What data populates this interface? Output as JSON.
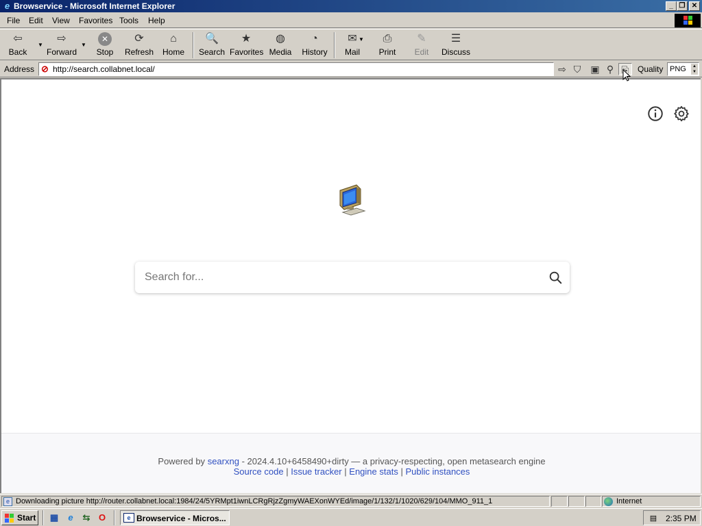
{
  "window": {
    "title": "Browservice - Microsoft Internet Explorer",
    "controls": {
      "minimize": "_",
      "maximize": "❐",
      "close": "✕"
    }
  },
  "menu": {
    "items": [
      "File",
      "Edit",
      "View",
      "Favorites",
      "Tools",
      "Help"
    ]
  },
  "toolbar": {
    "back": "Back",
    "forward": "Forward",
    "stop": "Stop",
    "refresh": "Refresh",
    "home": "Home",
    "search": "Search",
    "favorites": "Favorites",
    "media": "Media",
    "history": "History",
    "mail": "Mail",
    "print": "Print",
    "edit": "Edit",
    "discuss": "Discuss"
  },
  "address": {
    "label": "Address",
    "url": "http://search.collabnet.local/",
    "quality_label": "Quality",
    "quality_value": "PNG"
  },
  "page": {
    "search_placeholder": "Search for...",
    "footer": {
      "powered_by": "Powered by",
      "engine_name": "searxng",
      "version_text": "- 2024.4.10+6458490+dirty — a privacy-respecting, open metasearch engine",
      "links": [
        "Source code",
        "Issue tracker",
        "Engine stats",
        "Public instances"
      ],
      "separator": "|"
    }
  },
  "status": {
    "text": "Downloading picture http://router.collabnet.local:1984/24/5YRMpt1iwnLCRgRjzZgmyWAEXonWYEd/image/1/132/1/1020/629/104/MMO_911_1",
    "zone": "Internet"
  },
  "taskbar": {
    "start": "Start",
    "task_title": "Browservice - Micros...",
    "clock": "2:35 PM"
  },
  "colors": {
    "titlebar_start": "#0a246a",
    "titlebar_end": "#3a6ea5",
    "window_face": "#d4d0c8",
    "link": "#3050c0"
  }
}
